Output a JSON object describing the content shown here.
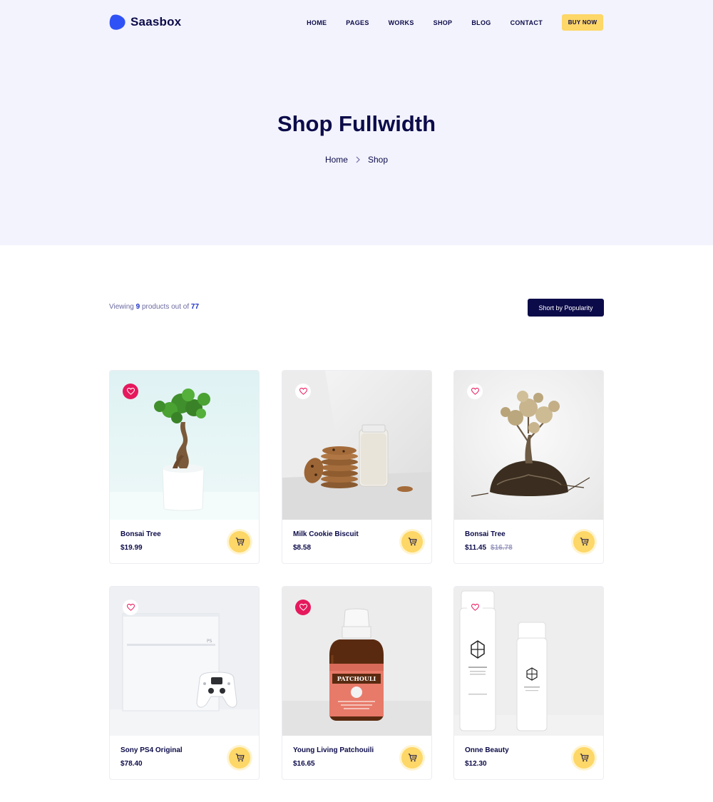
{
  "brand": {
    "name": "Saasbox",
    "color": "#2f52f6"
  },
  "nav": {
    "items": [
      "HOME",
      "PAGES",
      "WORKS",
      "SHOP",
      "BLOG",
      "CONTACT"
    ],
    "cta": "BUY NOW"
  },
  "hero": {
    "title": "Shop Fullwidth",
    "breadcrumb": [
      "Home",
      "Shop"
    ]
  },
  "toolbar": {
    "viewing_prefix": "Viewing",
    "viewing_count": "9",
    "viewing_middle": "products out of",
    "viewing_total": "77",
    "sort_label": "Short by Popularity"
  },
  "products": [
    {
      "name": "Bonsai Tree",
      "price": "$19.99",
      "old_price": "",
      "wishlisted": true,
      "image": "bonsai-plant"
    },
    {
      "name": "Milk Cookie Biscuit",
      "price": "$8.58",
      "old_price": "",
      "wishlisted": false,
      "image": "milk-cookies"
    },
    {
      "name": "Bonsai Tree",
      "price": "$11.45",
      "old_price": "$16.78",
      "wishlisted": false,
      "image": "dry-tree"
    },
    {
      "name": "Sony PS4 Original",
      "price": "$78.40",
      "old_price": "",
      "wishlisted": false,
      "image": "ps4-console"
    },
    {
      "name": "Young Living Patchouili",
      "price": "$16.65",
      "old_price": "",
      "wishlisted": true,
      "image": "oil-bottle"
    },
    {
      "name": "Onne Beauty",
      "price": "$12.30",
      "old_price": "",
      "wishlisted": false,
      "image": "cream-bottles"
    }
  ],
  "icons": {
    "wishlist": "heart-icon",
    "cart": "cart-icon",
    "breadcrumb_separator": "chevron-right-icon"
  },
  "colors": {
    "navy": "#0c0b4a",
    "accent_yellow": "#fdd767",
    "wishlist_pink": "#e6195d",
    "hero_bg": "#f3f3fd"
  }
}
